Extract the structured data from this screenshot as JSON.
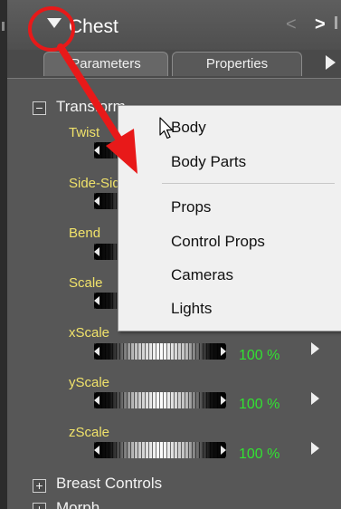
{
  "panel": {
    "title": "Chest",
    "nav_prev": "<",
    "nav_next": ">"
  },
  "tabs": [
    {
      "label": "Parameters"
    },
    {
      "label": "Properties"
    }
  ],
  "groups": {
    "transform": {
      "label": "Transform",
      "expander": "−"
    },
    "breast_controls": {
      "label": "Breast Controls",
      "expander": "+"
    },
    "morph": {
      "label": "Morph",
      "expander": "+"
    }
  },
  "params": [
    {
      "label": "Twist",
      "value": ""
    },
    {
      "label": "Side-Side",
      "value": ""
    },
    {
      "label": "Bend",
      "value": ""
    },
    {
      "label": "Scale",
      "value": ""
    },
    {
      "label": "xScale",
      "value": "100 %"
    },
    {
      "label": "yScale",
      "value": "100 %"
    },
    {
      "label": "zScale",
      "value": "100 %"
    }
  ],
  "popup_menu": {
    "items": [
      {
        "label": "Body"
      },
      {
        "label": "Body Parts"
      },
      {
        "label": "Props"
      },
      {
        "label": "Control Props"
      },
      {
        "label": "Cameras"
      },
      {
        "label": "Lights"
      }
    ]
  },
  "annotation": {
    "color": "#e81919",
    "marks": [
      "circle",
      "arrow"
    ]
  },
  "colors": {
    "panel_bg": "#575757",
    "param_label": "#f0e26a",
    "param_value": "#32e232",
    "menu_bg": "#f0f0f0"
  }
}
